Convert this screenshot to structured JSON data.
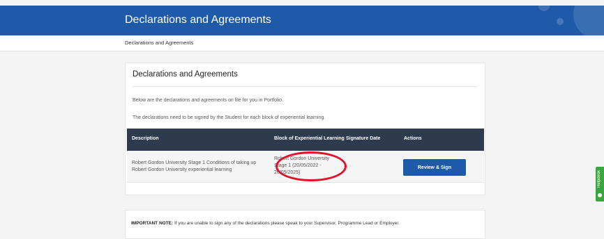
{
  "header": {
    "title": "Declarations and Agreements"
  },
  "breadcrumb": {
    "current": "Declarations and Agreements"
  },
  "card": {
    "heading": "Declarations and Agreements",
    "intro": "Below are the declarations and agreements on file for you in Portfolio.",
    "instruction": "The declarations need to be signed by the Student for each block of experiential learning."
  },
  "table": {
    "columns": [
      "Description",
      "Block of Experiential Learning",
      "Signature Date",
      "Actions"
    ],
    "rows": [
      {
        "description_line1": "Robert Gordon University Stage 1 Conditions of taking up",
        "description_line2": "Robert Gordon University experiential learning",
        "block_line1": "Robert Gordon University",
        "block_line2": "Stage 1 (20/05/2022 -",
        "block_line3": "20/05/2025)",
        "signature_date": "",
        "action_label": "Review & Sign"
      }
    ]
  },
  "note": {
    "label": "IMPORTANT NOTE:",
    "text": " If you are unable to sign any of the declarations please speak to your Supervisor, Programme Lead or Employer."
  },
  "helpdesk": {
    "label": "Helpdesk",
    "color": "#3aa640"
  },
  "colors": {
    "banner": "#1e5aa8",
    "table_header": "#2e3a4e",
    "highlight_ring": "#e3122a",
    "button": "#1e5aa8"
  }
}
